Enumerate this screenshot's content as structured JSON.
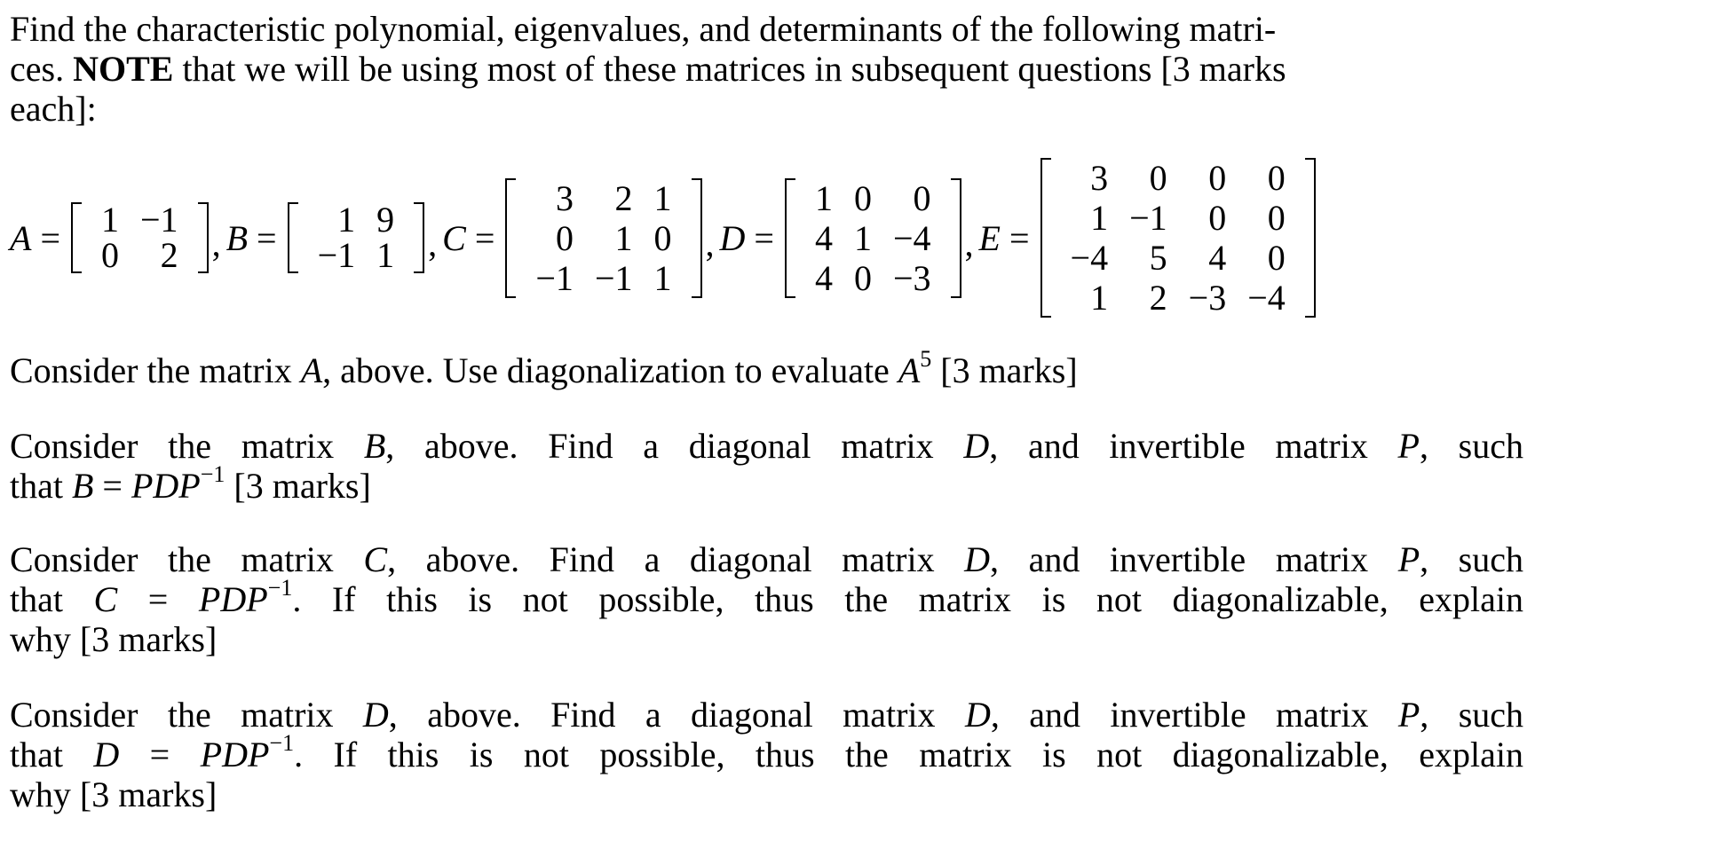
{
  "intro": {
    "line1": "Find the characteristic polynomial, eigenvalues, and determinants of the following matri-",
    "line2_pre": "ces. ",
    "line2_bold": "NOTE",
    "line2_post": " that we will be using most of these matrices in subsequent questions [3 marks",
    "line3": "each]:"
  },
  "symbols": {
    "equals": "=",
    "comma": ","
  },
  "matrices": [
    {
      "name": "A",
      "rows": [
        [
          "1",
          "−1"
        ],
        [
          "0",
          "2"
        ]
      ]
    },
    {
      "name": "B",
      "rows": [
        [
          "1",
          "9"
        ],
        [
          "−1",
          "1"
        ]
      ]
    },
    {
      "name": "C",
      "rows": [
        [
          "3",
          "2",
          "1"
        ],
        [
          "0",
          "1",
          "0"
        ],
        [
          "−1",
          "−1",
          "1"
        ]
      ]
    },
    {
      "name": "D",
      "rows": [
        [
          "1",
          "0",
          "0"
        ],
        [
          "4",
          "1",
          "−4"
        ],
        [
          "4",
          "0",
          "−3"
        ]
      ]
    },
    {
      "name": "E",
      "rows": [
        [
          "3",
          "0",
          "0",
          "0"
        ],
        [
          "1",
          "−1",
          "0",
          "0"
        ],
        [
          "−4",
          "5",
          "4",
          "0"
        ],
        [
          "1",
          "2",
          "−3",
          "−4"
        ]
      ]
    }
  ],
  "questions": [
    {
      "id": "q-a",
      "lines": [
        [
          {
            "t": "Consider the matrix "
          },
          {
            "m": "A"
          },
          {
            "t": ", above. Use diagonalization to evaluate "
          },
          {
            "m": "A"
          },
          {
            "sup": "5"
          },
          {
            "t": " [3 marks]"
          }
        ]
      ]
    },
    {
      "id": "q-b",
      "lines": [
        [
          {
            "t": "Consider the matrix "
          },
          {
            "m": "B"
          },
          {
            "t": ", above. Find a diagonal matrix "
          },
          {
            "m": "D"
          },
          {
            "t": ", and invertible matrix "
          },
          {
            "m": "P"
          },
          {
            "t": ", such"
          }
        ],
        [
          {
            "t": "that "
          },
          {
            "m": "B"
          },
          {
            "t": " = "
          },
          {
            "m": "PDP"
          },
          {
            "sup": "−1"
          },
          {
            "t": " [3 marks]"
          }
        ]
      ]
    },
    {
      "id": "q-c",
      "lines": [
        [
          {
            "t": "Consider the matrix "
          },
          {
            "m": "C"
          },
          {
            "t": ", above. Find a diagonal matrix "
          },
          {
            "m": "D"
          },
          {
            "t": ", and invertible matrix "
          },
          {
            "m": "P"
          },
          {
            "t": ", such"
          }
        ],
        [
          {
            "t": "that "
          },
          {
            "m": "C"
          },
          {
            "t": " = "
          },
          {
            "m": "PDP"
          },
          {
            "sup": "−1"
          },
          {
            "t": ". If this is not possible, thus the matrix is not diagonalizable, explain"
          }
        ],
        [
          {
            "t": "why [3 marks]"
          }
        ]
      ]
    },
    {
      "id": "q-d",
      "lines": [
        [
          {
            "t": "Consider the matrix "
          },
          {
            "m": "D"
          },
          {
            "t": ", above. Find a diagonal matrix "
          },
          {
            "m": "D"
          },
          {
            "t": ", and invertible matrix "
          },
          {
            "m": "P"
          },
          {
            "t": ", such"
          }
        ],
        [
          {
            "t": "that "
          },
          {
            "m": "D"
          },
          {
            "t": " = "
          },
          {
            "m": "PDP"
          },
          {
            "sup": "−1"
          },
          {
            "t": ". If this is not possible, thus the matrix is not diagonalizable, explain"
          }
        ],
        [
          {
            "t": "why [3 marks]"
          }
        ]
      ]
    }
  ]
}
